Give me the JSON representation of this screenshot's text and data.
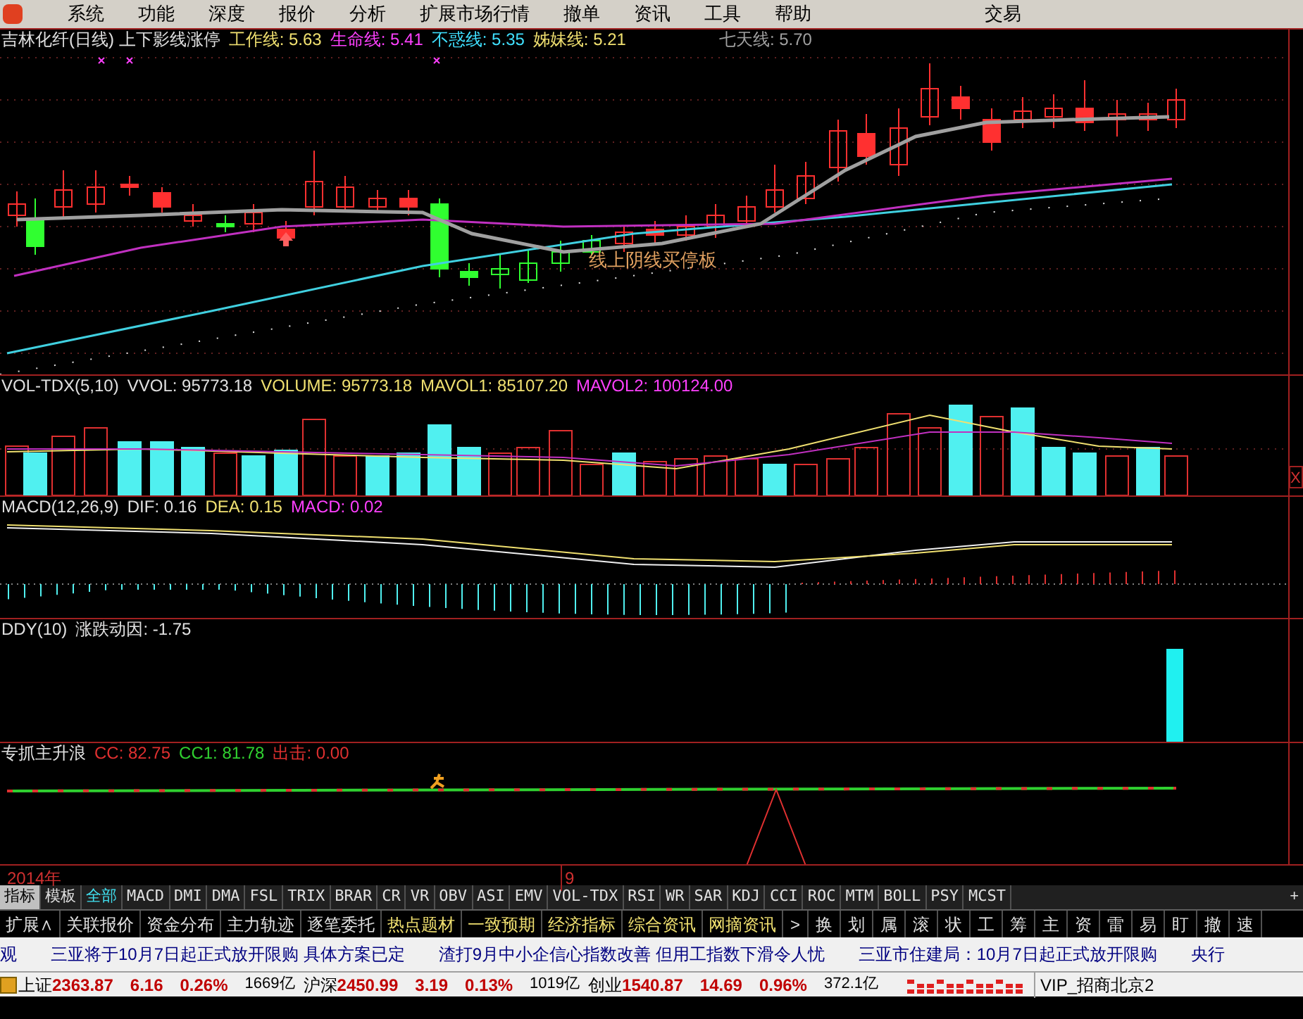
{
  "menu": {
    "items": [
      "系统",
      "功能",
      "深度",
      "报价",
      "分析",
      "扩展市场行情",
      "撤单",
      "资讯",
      "工具",
      "帮助"
    ],
    "right": "交易"
  },
  "main_pane": {
    "legend": [
      {
        "text": "吉林化纤(日线) 上下影线涨停",
        "color": "#e0e0e0"
      },
      {
        "text": "工作线: 5.63",
        "color": "#f0e070"
      },
      {
        "text": "生命线: 5.41",
        "color": "#ff40ff"
      },
      {
        "text": "不惑线: 5.35",
        "color": "#40e0ff"
      },
      {
        "text": "姊妹线: 5.21",
        "color": "#f0e070"
      },
      {
        "text": "七天线: 5.70",
        "color": "#a0a0a0"
      }
    ],
    "annotation": "线上阴线买停板"
  },
  "vol_pane": {
    "legend": [
      {
        "text": "VOL-TDX(5,10)",
        "color": "#e0e0e0"
      },
      {
        "text": "VVOL: 95773.18",
        "color": "#e0e0e0"
      },
      {
        "text": "VOLUME: 95773.18",
        "color": "#f0e070"
      },
      {
        "text": "MAVOL1: 85107.20",
        "color": "#f0e070"
      },
      {
        "text": "MAVOL2: 100124.00",
        "color": "#ff40ff"
      }
    ],
    "close": "X"
  },
  "macd_pane": {
    "legend": [
      {
        "text": "MACD(12,26,9)",
        "color": "#e0e0e0"
      },
      {
        "text": "DIF: 0.16",
        "color": "#e0e0e0"
      },
      {
        "text": "DEA: 0.15",
        "color": "#f0e070"
      },
      {
        "text": "MACD: 0.02",
        "color": "#ff40ff"
      }
    ]
  },
  "ddy_pane": {
    "legend": [
      {
        "text": "DDY(10)",
        "color": "#e0e0e0"
      },
      {
        "text": "涨跌动因: -1.75",
        "color": "#e0e0e0"
      }
    ]
  },
  "wave_pane": {
    "legend": [
      {
        "text": "专抓主升浪",
        "color": "#e0e0e0"
      },
      {
        "text": "CC: 82.75",
        "color": "#e03030"
      },
      {
        "text": "CC1: 81.78",
        "color": "#30d030"
      },
      {
        "text": "出击: 0.00",
        "color": "#e03030"
      }
    ]
  },
  "date_axis": [
    "2014年",
    "9"
  ],
  "indicator_tabs": [
    {
      "label": "指标",
      "selected": true
    },
    {
      "label": "模板",
      "selected": false
    },
    {
      "label": "全部",
      "selected": false
    },
    {
      "label": "MACD",
      "selected": false
    },
    {
      "label": "DMI",
      "selected": false
    },
    {
      "label": "DMA",
      "selected": false
    },
    {
      "label": "FSL",
      "selected": false
    },
    {
      "label": "TRIX",
      "selected": false
    },
    {
      "label": "BRAR",
      "selected": false
    },
    {
      "label": "CR",
      "selected": false
    },
    {
      "label": "VR",
      "selected": false
    },
    {
      "label": "OBV",
      "selected": false
    },
    {
      "label": "ASI",
      "selected": false
    },
    {
      "label": "EMV",
      "selected": false
    },
    {
      "label": "VOL-TDX",
      "selected": false
    },
    {
      "label": "RSI",
      "selected": false
    },
    {
      "label": "WR",
      "selected": false
    },
    {
      "label": "SAR",
      "selected": false
    },
    {
      "label": "KDJ",
      "selected": false
    },
    {
      "label": "CCI",
      "selected": false
    },
    {
      "label": "ROC",
      "selected": false
    },
    {
      "label": "MTM",
      "selected": false
    },
    {
      "label": "BOLL",
      "selected": false
    },
    {
      "label": "PSY",
      "selected": false
    },
    {
      "label": "MCST",
      "selected": false
    }
  ],
  "indicator_more": "+",
  "function_tabs": [
    {
      "label": "扩展∧",
      "highlighted": false
    },
    {
      "label": "关联报价",
      "highlighted": false
    },
    {
      "label": "资金分布",
      "highlighted": false
    },
    {
      "label": "主力轨迹",
      "highlighted": false
    },
    {
      "label": "逐笔委托",
      "highlighted": false
    },
    {
      "label": "热点题材",
      "highlighted": true
    },
    {
      "label": "一致预期",
      "highlighted": true
    },
    {
      "label": "经济指标",
      "highlighted": true
    },
    {
      "label": "综合资讯",
      "highlighted": true
    },
    {
      "label": "网摘资讯",
      "highlighted": true
    },
    {
      "label": ">",
      "highlighted": false
    },
    {
      "label": "换",
      "highlighted": false
    },
    {
      "label": "划",
      "highlighted": false
    },
    {
      "label": "属",
      "highlighted": false
    },
    {
      "label": "滚",
      "highlighted": false
    },
    {
      "label": "状",
      "highlighted": false
    },
    {
      "label": "工",
      "highlighted": false
    },
    {
      "label": "筹",
      "highlighted": false
    },
    {
      "label": "主",
      "highlighted": false
    },
    {
      "label": "资",
      "highlighted": false
    },
    {
      "label": "雷",
      "highlighted": false
    },
    {
      "label": "易",
      "highlighted": false
    },
    {
      "label": "盯",
      "highlighted": false
    },
    {
      "label": "撤",
      "highlighted": false
    },
    {
      "label": "速",
      "highlighted": false
    }
  ],
  "news": [
    "观",
    "三亚将于10月7日起正式放开限购 具体方案已定",
    "渣打9月中小企信心指数改善 但用工指数下滑令人忧",
    "三亚市住建局：10月7日起正式放开限购",
    "央行"
  ],
  "indices": [
    {
      "name": "上证",
      "price": "2363.87",
      "change": "6.16",
      "percent": "0.26%",
      "amount": "1669亿"
    },
    {
      "name": "沪深",
      "price": "2450.99",
      "change": "3.19",
      "percent": "0.13%",
      "amount": "1019亿"
    },
    {
      "name": "创业",
      "price": "1540.87",
      "change": "14.69",
      "percent": "0.96%",
      "amount": "372.1亿"
    }
  ],
  "server": "VIP_招商北京2"
}
